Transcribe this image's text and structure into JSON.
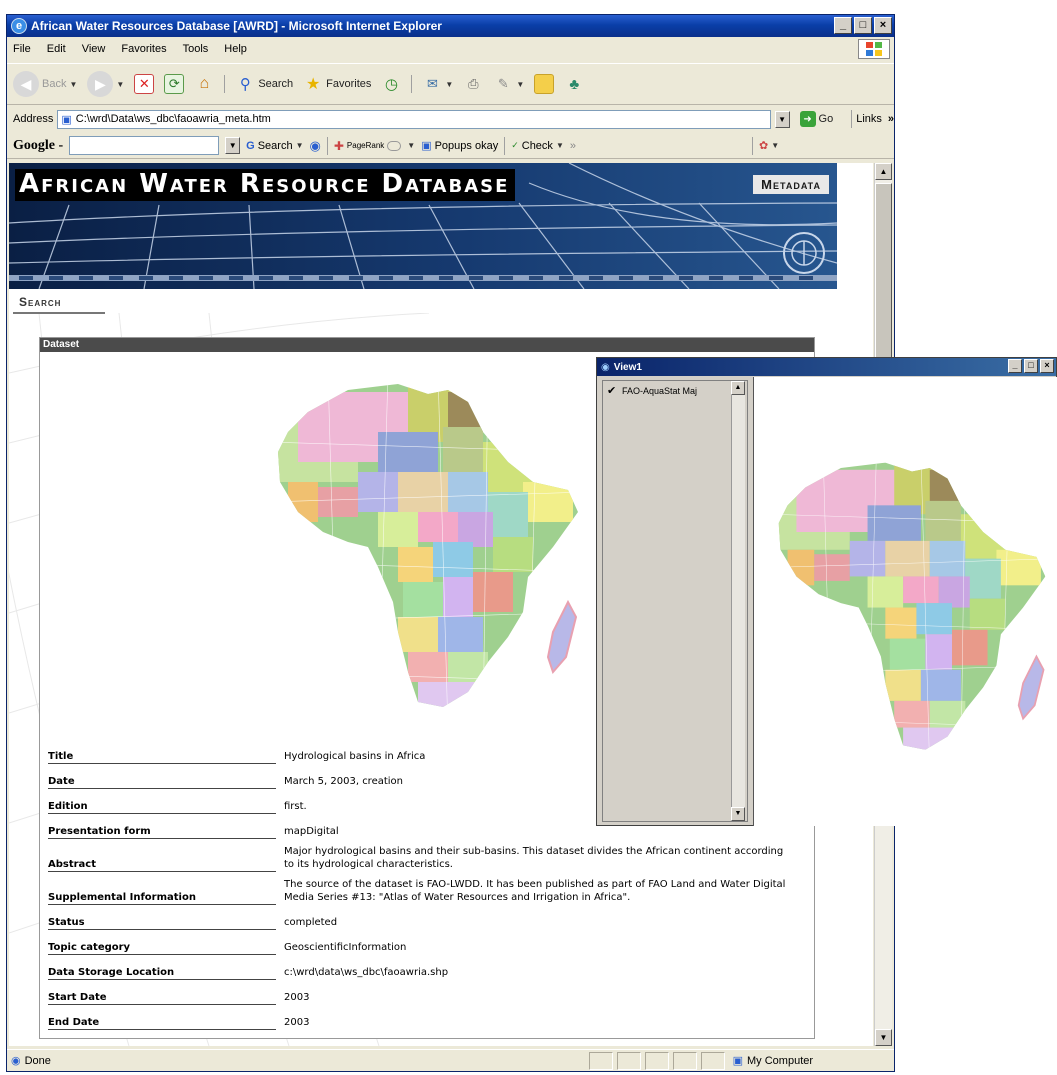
{
  "browser": {
    "title": "African Water Resources Database [AWRD] - Microsoft Internet Explorer",
    "window_buttons": [
      "_",
      "□",
      "×"
    ],
    "menu": [
      "File",
      "Edit",
      "View",
      "Favorites",
      "Tools",
      "Help"
    ],
    "toolbar": {
      "back": "Back",
      "search": "Search",
      "favorites": "Favorites"
    },
    "address": {
      "label": "Address",
      "value": "C:\\wrd\\Data\\ws_dbc\\faoawria_meta.htm",
      "go": "Go",
      "links": "Links",
      "more": "»"
    },
    "google_bar": {
      "logo": "Google -",
      "search": "Search",
      "pagerank": "PageRank",
      "popups": "Popups okay",
      "check": "Check",
      "more": "»"
    },
    "status": {
      "text": "Done",
      "zone": "My Computer"
    }
  },
  "page": {
    "banner_title": "African Water Resource Database",
    "banner_section": "Metadata",
    "search_link": "Search",
    "dataset_header": "Dataset",
    "metadata": [
      {
        "key": "Title",
        "value": "Hydrological basins in Africa"
      },
      {
        "key": "Date",
        "value": "March 5, 2003, creation"
      },
      {
        "key": "Edition",
        "value": "first."
      },
      {
        "key": "Presentation form",
        "value": "mapDigital"
      },
      {
        "key": "Abstract",
        "value": "Major hydrological basins and their sub-basins. This dataset divides the African continent according to its hydrological characteristics."
      },
      {
        "key": "Supplemental Information",
        "value": "The source of the dataset is FAO-LWDD. It has been published as part of FAO Land and Water Digital Media Series #13: \"Atlas of Water Resources and Irrigation in Africa\"."
      },
      {
        "key": "Status",
        "value": "completed"
      },
      {
        "key": "Topic category",
        "value": "GeoscientificInformation"
      },
      {
        "key": "Data Storage Location",
        "value": "c:\\wrd\\data\\ws_dbc\\faoawria.shp"
      },
      {
        "key": "Start Date",
        "value": "2003"
      },
      {
        "key": "End Date",
        "value": "2003"
      }
    ]
  },
  "view_window": {
    "title": "View1",
    "layer": "FAO-AquaStat Maj"
  }
}
